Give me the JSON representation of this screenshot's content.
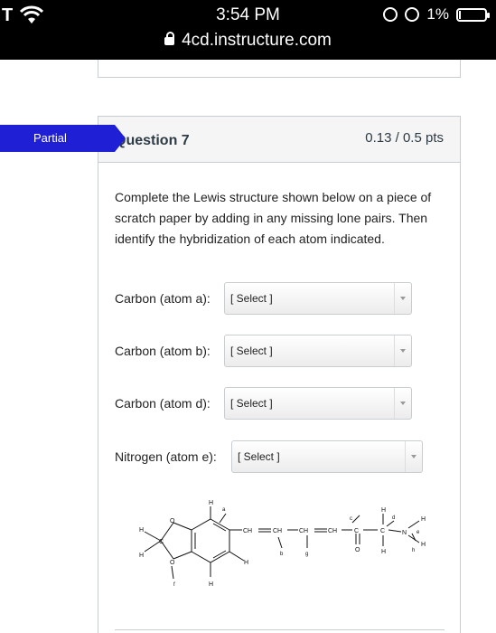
{
  "status_bar": {
    "carrier": "T",
    "time": "3:54 PM",
    "battery": "1%",
    "url": "4cd.instructure.com"
  },
  "question": {
    "status_badge": "Partial",
    "title": "Question 7",
    "points": "0.13 / 0.5 pts",
    "text": "Complete the Lewis structure shown below on a piece of scratch paper by adding in any missing lone pairs. Then identify the hybridization of each atom indicated."
  },
  "answers": [
    {
      "label": "Carbon (atom a):",
      "selected": "[ Select ]"
    },
    {
      "label": "Carbon (atom b):",
      "selected": "[ Select ]"
    },
    {
      "label": "Carbon (atom d):",
      "selected": "[ Select ]"
    },
    {
      "label": "Nitrogen (atom e):",
      "selected": "[ Select ]"
    }
  ],
  "molecule_labels": {
    "atoms_H": "H",
    "atoms_O": "O",
    "atoms_C": "C",
    "atoms_N": "N",
    "ch": "CH",
    "a": "a",
    "b": "b",
    "c": "c",
    "d": "d",
    "e": "e",
    "f": "f",
    "g": "g",
    "h": "h"
  },
  "colors": {
    "partial_badge": "#1f1fd6",
    "header_bg": "#f5f5f5",
    "border": "#c7cdd1"
  }
}
